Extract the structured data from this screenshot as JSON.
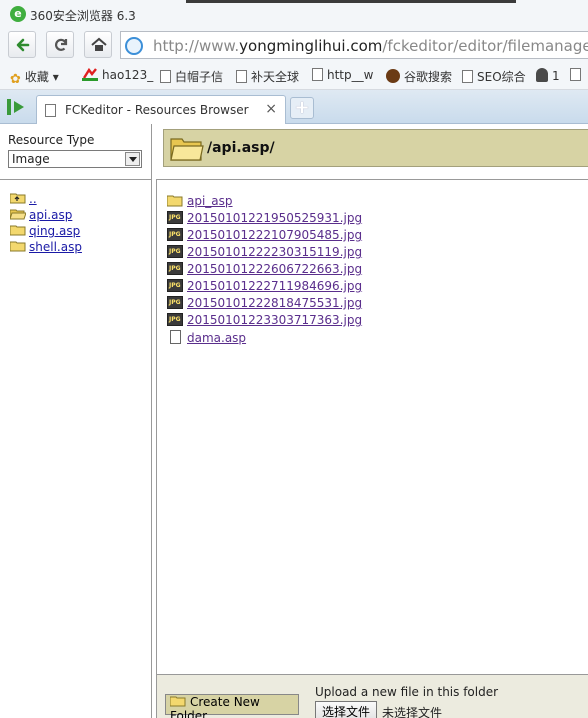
{
  "window": {
    "title": "360安全浏览器 6.3"
  },
  "address_bar": {
    "url_host": "http://www.",
    "url_domain": "yongminglihui.com",
    "url_path": "/fckeditor/editor/filemanage"
  },
  "bookmarks": [
    {
      "label": "收藏",
      "icon": "star-icon"
    },
    {
      "label": "hao123_",
      "icon": "hao123-icon"
    },
    {
      "label": "白帽子信",
      "icon": "page-icon"
    },
    {
      "label": "补天全球",
      "icon": "page-icon"
    },
    {
      "label": "http__w",
      "icon": "page-icon"
    },
    {
      "label": "谷歌搜索",
      "icon": "google-icon"
    },
    {
      "label": "SEO综合",
      "icon": "page-icon"
    },
    {
      "label": "1",
      "icon": "hacker-icon"
    }
  ],
  "tabs": [
    {
      "label": "FCKeditor - Resources Browser",
      "close": "×"
    }
  ],
  "new_tab_symbol": "+",
  "resource_type": {
    "label": "Resource Type",
    "selected": "Image"
  },
  "folder_tree": [
    {
      "label": "..",
      "type": "up"
    },
    {
      "label": "api.asp",
      "type": "folder-open"
    },
    {
      "label": "qing.asp",
      "type": "folder"
    },
    {
      "label": "shell.asp",
      "type": "folder"
    }
  ],
  "current_folder": "/api.asp/",
  "files": [
    {
      "name": "api_asp",
      "type": "folder"
    },
    {
      "name": "20150101221950525931.jpg",
      "type": "jpg"
    },
    {
      "name": "20150101222107905485.jpg",
      "type": "jpg"
    },
    {
      "name": "20150101222230315119.jpg",
      "type": "jpg"
    },
    {
      "name": "20150101222606722663.jpg",
      "type": "jpg"
    },
    {
      "name": "20150101222711984696.jpg",
      "type": "jpg"
    },
    {
      "name": "20150101222818475531.jpg",
      "type": "jpg"
    },
    {
      "name": "20150101223303717363.jpg",
      "type": "jpg"
    },
    {
      "name": "dama.asp",
      "type": "file"
    }
  ],
  "footer": {
    "create_folder": "Create New Folder",
    "upload_label": "Upload a new file in this folder",
    "choose_file": "选择文件",
    "no_file": "未选择文件"
  },
  "colors": {
    "header_bg": "#d7d3a4",
    "link": "#1a1aa6",
    "visited_link": "#5a2e8c",
    "folder": "#f3d86e"
  }
}
